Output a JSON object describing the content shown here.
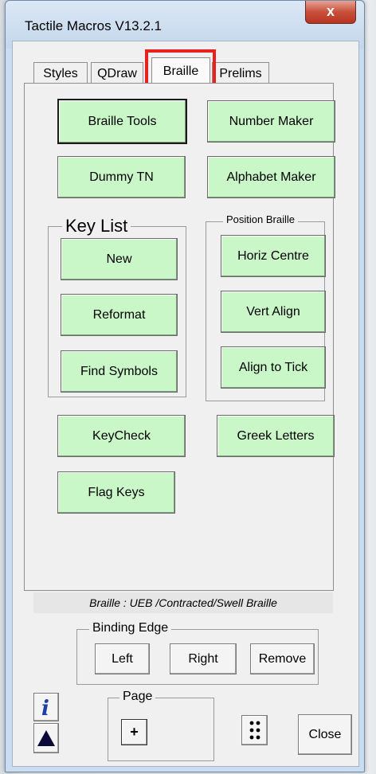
{
  "window": {
    "title": "Tactile Macros V13.2.1",
    "close_glyph": "x"
  },
  "tabs": [
    {
      "label": "Styles",
      "active": false
    },
    {
      "label": "QDraw",
      "active": false
    },
    {
      "label": "Braille",
      "active": true
    },
    {
      "label": "Prelims",
      "active": false
    }
  ],
  "buttons": {
    "braille_tools": "Braille Tools",
    "number_maker": "Number Maker",
    "dummy_tn": "Dummy TN",
    "alphabet_maker": "Alphabet Maker",
    "new": "New",
    "reformat": "Reformat",
    "find_symbols": "Find Symbols",
    "horiz_centre": "Horiz Centre",
    "vert_align": "Vert Align",
    "align_to_tick": "Align to Tick",
    "keycheck": "KeyCheck",
    "greek_letters": "Greek Letters",
    "flag_keys": "Flag Keys",
    "left": "Left",
    "right": "Right",
    "remove": "Remove",
    "page_plus": "+",
    "close": "Close"
  },
  "groups": {
    "key_list": "Key List",
    "position_braille": "Position Braille",
    "binding_edge": "Binding Edge",
    "page": "Page"
  },
  "status_text": "Braille : UEB /Contracted/Swell Braille",
  "icons": {
    "info": "info-icon",
    "triangle": "triangle-up-icon",
    "braille": "braille-cell-icon"
  },
  "colors": {
    "button_green": "#c9f7c7",
    "highlight_red": "#e8211c"
  }
}
